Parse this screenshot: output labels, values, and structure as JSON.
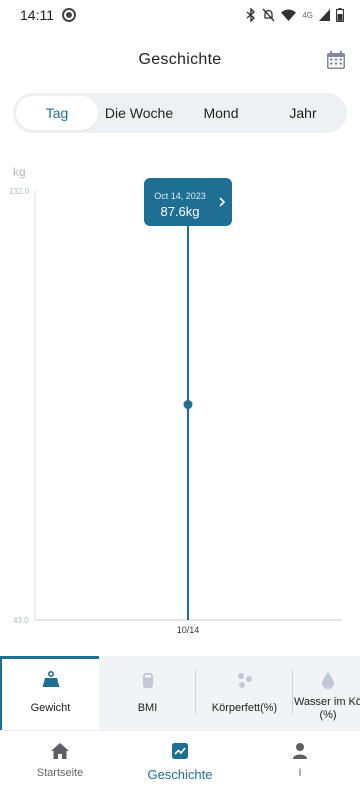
{
  "status_bar": {
    "time": "14:11",
    "network": "4G"
  },
  "header": {
    "title": "Geschichte",
    "calendar_icon": "calendar-icon"
  },
  "tabs": [
    {
      "label": "Tag",
      "active": true
    },
    {
      "label": "Die Woche",
      "active": false
    },
    {
      "label": "Mond",
      "active": false
    },
    {
      "label": "Jahr",
      "active": false
    }
  ],
  "colors": {
    "accent": "#1f6f95",
    "tab_bg": "#eef0f4",
    "axis_text": "#b5bccb"
  },
  "chart_data": {
    "type": "line",
    "ylabel": "kg",
    "ylim": [
      43.0,
      132.0
    ],
    "y_tick_labels": [
      "132.0",
      "43.0"
    ],
    "x": [
      "10/14"
    ],
    "series": [
      {
        "values": [
          87.6
        ]
      }
    ],
    "tooltip": {
      "date": "Oct 14, 2023",
      "value_label": "87.6kg"
    },
    "grid": false
  },
  "metrics": [
    {
      "label": "Gewicht",
      "icon": "weight-icon",
      "active": true
    },
    {
      "label": "BMI",
      "icon": "bmi-icon",
      "active": false
    },
    {
      "label": "Körperfett(%)",
      "icon": "body-fat-icon",
      "active": false
    },
    {
      "label": "Wasser im Kö",
      "label2": "(%)",
      "icon": "water-drop-icon",
      "active": false
    }
  ],
  "bottom_nav": [
    {
      "label": "Startseite",
      "icon": "home-icon",
      "active": false
    },
    {
      "label": "Geschichte",
      "icon": "history-chart-icon",
      "active": true
    },
    {
      "label": "I",
      "icon": "person-icon",
      "active": false
    }
  ]
}
